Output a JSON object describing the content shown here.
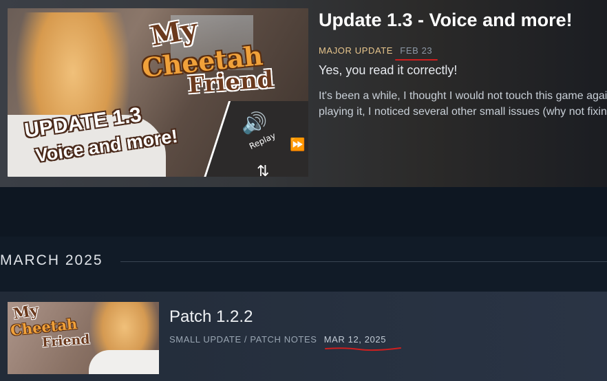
{
  "featured": {
    "thumbnail_text": {
      "logo_my": "My",
      "logo_cheetah": "Cheetah",
      "logo_friend": "Friend",
      "update_line1": "UPDATE 1.3",
      "update_line2": "Voice and more!",
      "replay_label": "Replay",
      "icons": [
        "replay-speaker-icon",
        "skip-icon",
        "auto-icon"
      ]
    },
    "title": "Update 1.3 - Voice and more!",
    "type": "MAJOR UPDATE",
    "date": "FEB 23",
    "subtitle": "Yes, you read it correctly!",
    "body_lines": [
      "It's been a while, I thought I would not touch this game again. But after some time",
      "playing it, I noticed several other small issues (why not fixing them?"
    ]
  },
  "month_header": "MARCH 2025",
  "card": {
    "thumbnail_text": {
      "logo_my": "My",
      "logo_cheetah": "Cheetah",
      "logo_friend": "Friend"
    },
    "title": "Patch 1.2.2",
    "type": "SMALL UPDATE / PATCH NOTES",
    "date": "MAR 12, 2025"
  },
  "colors": {
    "accent_major": "#e8c68d",
    "annotation_red": "#d01f1f",
    "background": "#0f1a26"
  }
}
